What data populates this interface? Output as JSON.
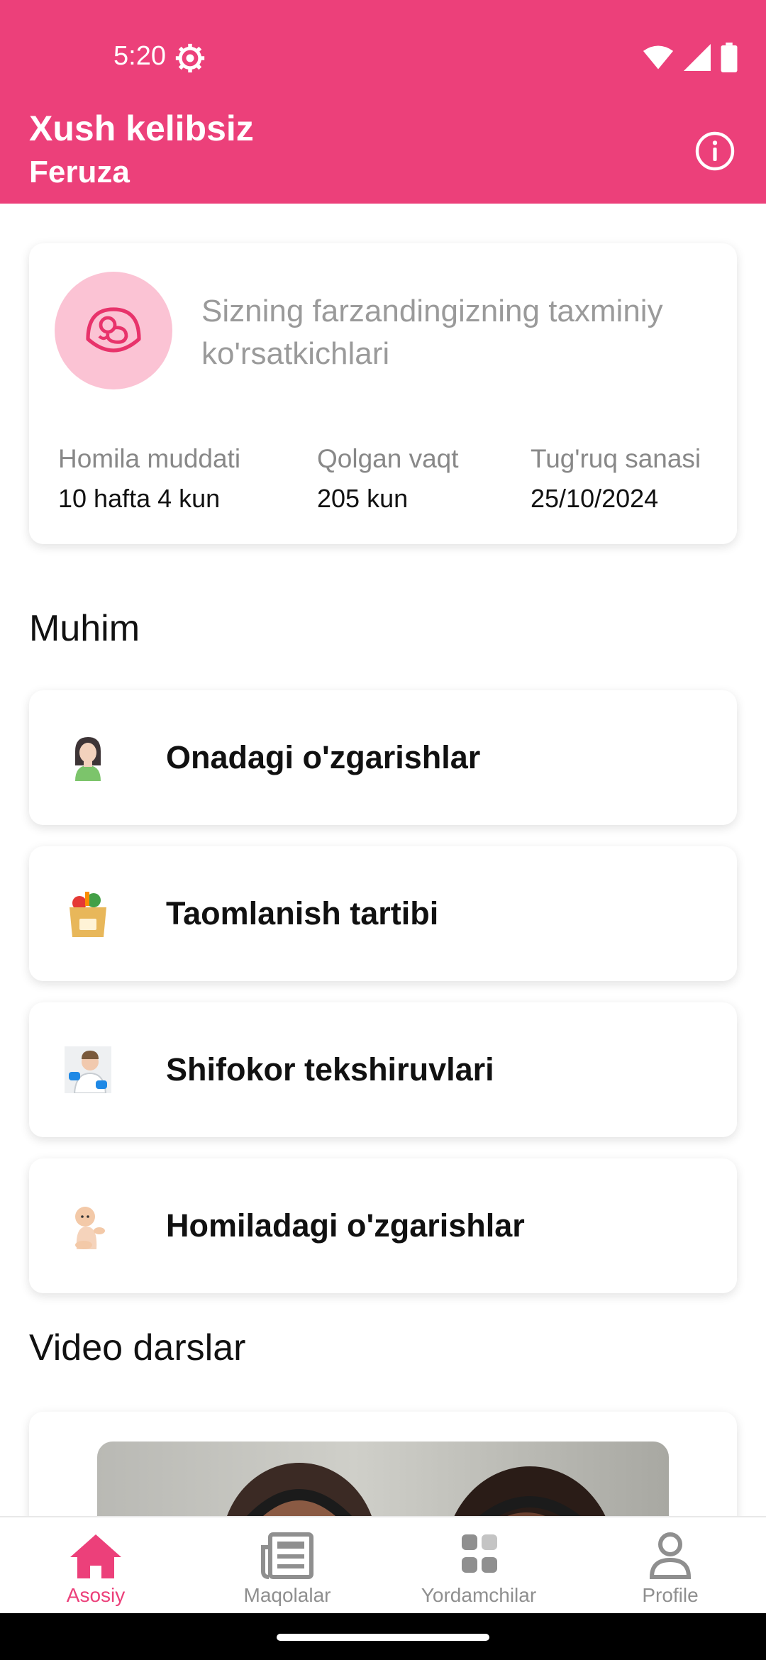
{
  "status_bar": {
    "time": "5:20"
  },
  "header": {
    "welcome": "Xush kelibsiz",
    "username": "Feruza"
  },
  "summary": {
    "title": "Sizning farzandingizning taxminiy ko'rsatkichlari",
    "stats": [
      {
        "label": "Homila muddati",
        "value": "10 hafta 4 kun"
      },
      {
        "label": "Qolgan vaqt",
        "value": "205 kun"
      },
      {
        "label": "Tug'ruq sanasi",
        "value": "25/10/2024"
      }
    ]
  },
  "important": {
    "title": "Muhim",
    "items": [
      {
        "label": "Onadagi o'zgarishlar",
        "icon": "mother-icon"
      },
      {
        "label": "Taomlanish tartibi",
        "icon": "grocery-bag-icon"
      },
      {
        "label": "Shifokor tekshiruvlari",
        "icon": "doctor-icon"
      },
      {
        "label": "Homiladagi o'zgarishlar",
        "icon": "baby-icon"
      }
    ]
  },
  "videos": {
    "title": "Video darslar"
  },
  "bottom_nav": {
    "items": [
      {
        "label": "Asosiy",
        "icon": "home-icon",
        "active": true
      },
      {
        "label": "Maqolalar",
        "icon": "newspaper-icon",
        "active": false
      },
      {
        "label": "Yordamchilar",
        "icon": "grid-icon",
        "active": false
      },
      {
        "label": "Profile",
        "icon": "person-icon",
        "active": false
      }
    ]
  },
  "colors": {
    "accent": "#ec407a",
    "accent_light": "#fbc3d4"
  }
}
